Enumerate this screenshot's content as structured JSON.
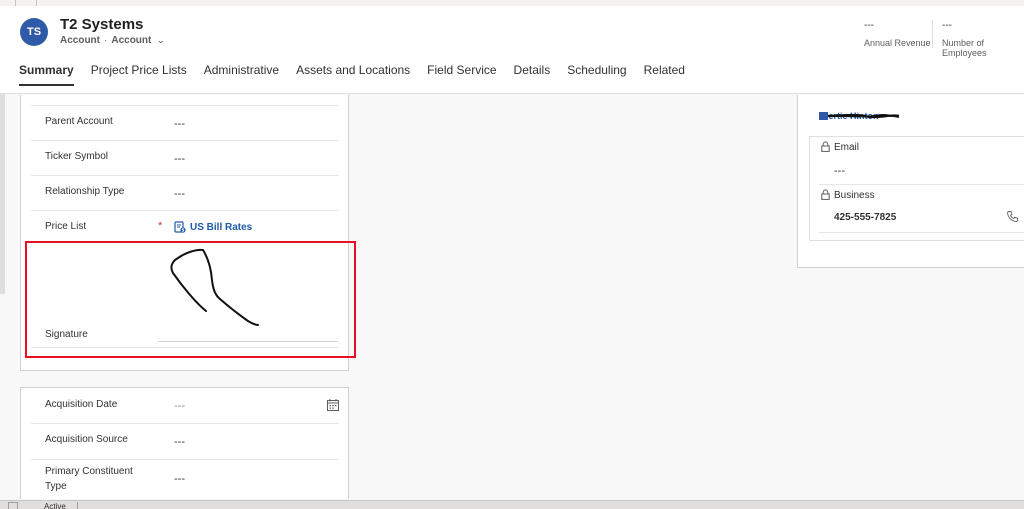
{
  "record": {
    "initials": "TS",
    "title": "T2 Systems",
    "entity": "Account",
    "form": "Account"
  },
  "header_fields": [
    {
      "value": "---",
      "label": "Annual Revenue"
    },
    {
      "value": "---",
      "label": "Number of Employees"
    }
  ],
  "tabs": [
    {
      "label": "Summary",
      "active": true
    },
    {
      "label": "Project Price Lists"
    },
    {
      "label": "Administrative"
    },
    {
      "label": "Assets and Locations"
    },
    {
      "label": "Field Service"
    },
    {
      "label": "Details"
    },
    {
      "label": "Scheduling"
    },
    {
      "label": "Related"
    }
  ],
  "section1": {
    "parent_account": {
      "label": "Parent Account",
      "value": "---"
    },
    "ticker_symbol": {
      "label": "Ticker Symbol",
      "value": "---"
    },
    "relationship_type": {
      "label": "Relationship Type",
      "value": "---"
    },
    "price_list": {
      "label": "Price List",
      "required_mark": "*",
      "value": "US Bill Rates"
    },
    "signature": {
      "label": "Signature"
    }
  },
  "section2": {
    "acquisition_date": {
      "label": "Acquisition Date",
      "value": "---"
    },
    "acquisition_source": {
      "label": "Acquisition Source",
      "value": "---"
    },
    "primary_constituent_type": {
      "label": "Primary Constituent Type",
      "value": "---"
    }
  },
  "contact": {
    "name": "Bertie Hinton",
    "email_label": "Email",
    "email_value": "---",
    "business_label": "Business",
    "business_value": "425-555-7825"
  },
  "status": {
    "text": "Active"
  },
  "colors": {
    "avatar": "#2f5aa8",
    "lookup_link": "#1f5ba8",
    "highlight": "#e81123",
    "required": "#d13438"
  }
}
